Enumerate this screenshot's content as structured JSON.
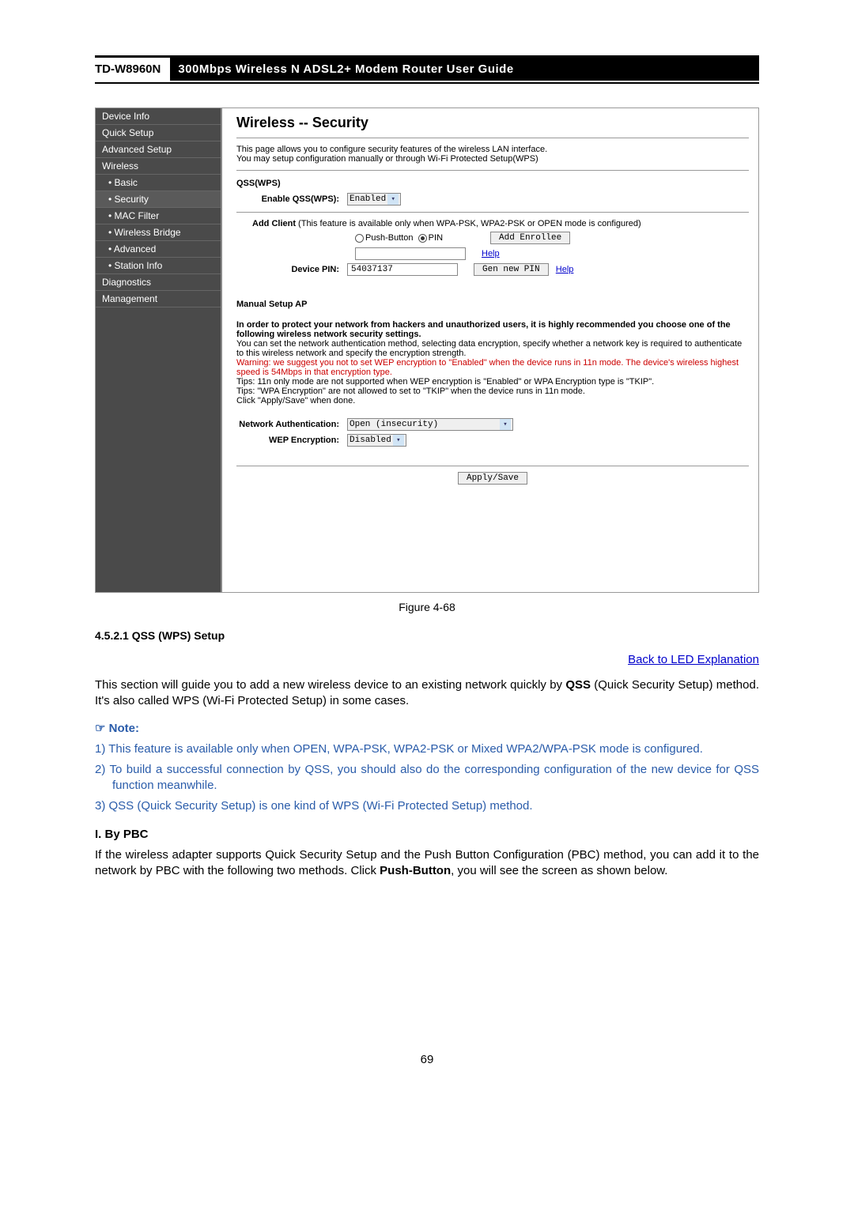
{
  "header": {
    "model": "TD-W8960N",
    "title": "300Mbps Wireless N ADSL2+ Modem Router User Guide"
  },
  "sidebar": {
    "items": [
      {
        "label": "Device Info",
        "sub": false
      },
      {
        "label": "Quick Setup",
        "sub": false
      },
      {
        "label": "Advanced Setup",
        "sub": false
      },
      {
        "label": "Wireless",
        "sub": false
      },
      {
        "label": "• Basic",
        "sub": true
      },
      {
        "label": "• Security",
        "sub": true
      },
      {
        "label": "• MAC Filter",
        "sub": true
      },
      {
        "label": "• Wireless Bridge",
        "sub": true
      },
      {
        "label": "• Advanced",
        "sub": true
      },
      {
        "label": "• Station Info",
        "sub": true
      },
      {
        "label": "Diagnostics",
        "sub": false
      },
      {
        "label": "Management",
        "sub": false
      }
    ]
  },
  "panel": {
    "title": "Wireless -- Security",
    "intro1": "This page allows you to configure security features of the wireless LAN interface.",
    "intro2": "You may setup configuration manually or through Wi-Fi Protected Setup(WPS)",
    "qss_heading": "QSS(WPS)",
    "enable_label": "Enable QSS(WPS):",
    "enable_value": "Enabled",
    "add_client_prefix": "Add Client",
    "add_client_note": " (This feature is available only when WPA-PSK, WPA2-PSK or OPEN mode is configured)",
    "push_button": "Push-Button",
    "pin": "PIN",
    "add_enrollee_btn": "Add Enrollee",
    "help": "Help",
    "device_pin_label": "Device PIN:",
    "device_pin_value": "54037137",
    "gen_new_pin": "Gen new PIN",
    "manual_heading": "Manual Setup AP",
    "p1a": "In order to protect your network from hackers and unauthorized users, it is highly recommended you choose one of the following wireless network security settings.",
    "p1b": "You can set the network authentication method, selecting data encryption, specify whether a network key is required to authenticate to this wireless network and specify the encryption strength.",
    "warn": "Warning: we suggest you not to set WEP encryption to \"Enabled\" when the device runs in 11n mode. The device's wireless highest speed is 54Mbps in that encryption type.",
    "tip1": "Tips: 11n only mode are not supported when WEP encryption is \"Enabled\" or WPA Encryption type is \"TKIP\".",
    "tip2": "Tips: \"WPA Encryption\" are not allowed to set to \"TKIP\" when the device runs in 11n mode.",
    "click": "Click \"Apply/Save\" when done.",
    "net_auth_label": "Network Authentication:",
    "net_auth_value": "Open (insecurity)",
    "wep_label": "WEP Encryption:",
    "wep_value": "Disabled",
    "apply_btn": "Apply/Save"
  },
  "figure_caption": "Figure 4-68",
  "section_number": "4.5.2.1   QSS (WPS) Setup",
  "back_link": "Back to LED Explanation",
  "body1_a": "This section will guide you to add a new wireless device to an existing network quickly by ",
  "body1_b": "QSS",
  "body1_c": " (Quick Security Setup) method. It's also called WPS (Wi-Fi Protected Setup) in some cases.",
  "note_header": "☞  Note:",
  "notes": [
    "1)  This feature is available only when OPEN, WPA-PSK, WPA2-PSK or Mixed WPA2/WPA-PSK mode is configured.",
    "2)  To build a successful connection by QSS, you should also do the corresponding configuration of the new device for QSS function meanwhile.",
    "3)  QSS (Quick Security Setup) is one kind of WPS (Wi-Fi Protected Setup) method."
  ],
  "sub_header": "I.  By PBC",
  "body2_a": "If the wireless adapter supports Quick Security Setup and the Push Button Configuration (PBC) method, you can add it to the network by PBC with the following two methods. Click ",
  "body2_b": "Push-Button",
  "body2_c": ", you will see the screen as shown below.",
  "page_number": "69"
}
